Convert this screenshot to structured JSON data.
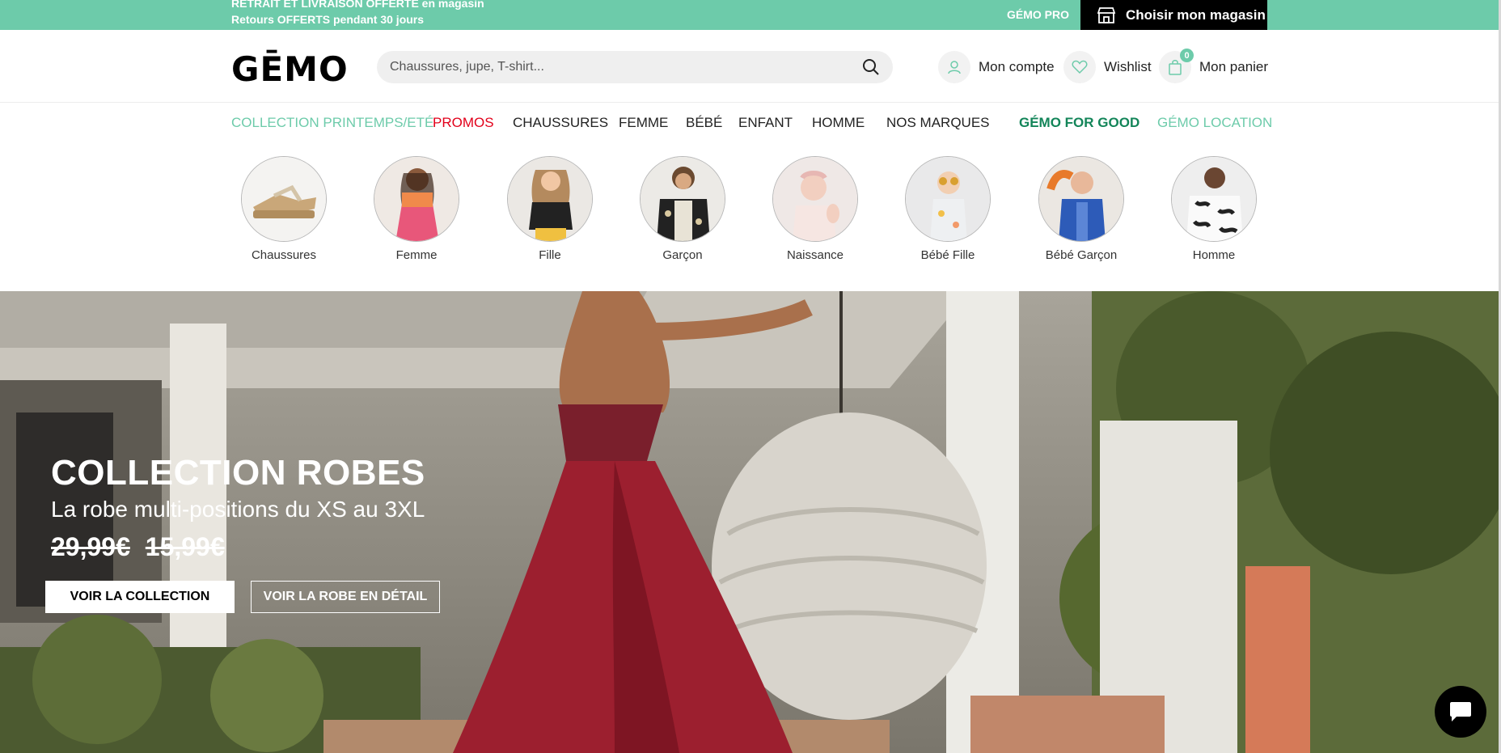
{
  "topbar": {
    "msg_line1": "RETRAIT ET LIVRAISON OFFERTE en magasin",
    "msg_line2": "Retours OFFERTS pendant 30 jours",
    "gemo_pro": "GÉMO PRO",
    "store_button": "Choisir mon magasin"
  },
  "header": {
    "logo": "GĒMO",
    "search_placeholder": "Chaussures, jupe, T-shirt...",
    "account": "Mon compte",
    "wishlist": "Wishlist",
    "cart": "Mon panier",
    "cart_count": "0"
  },
  "nav": {
    "items": [
      "COLLECTION PRINTEMPS/ETÉ",
      "PROMOS",
      "CHAUSSURES",
      "FEMME",
      "BÉBÉ",
      "ENFANT",
      "HOMME",
      "NOS MARQUES",
      "GÉMO FOR GOOD",
      "GÉMO LOCATION"
    ]
  },
  "categories": [
    "Chaussures",
    "Femme",
    "Fille",
    "Garçon",
    "Naissance",
    "Bébé Fille",
    "Bébé Garçon",
    "Homme"
  ],
  "hero": {
    "title": "COLLECTION ROBES",
    "subtitle": "La robe multi-positions du XS au 3XL",
    "price_old": "29,99€",
    "price_new": "15,99€",
    "cta_primary": "VOIR LA COLLECTION",
    "cta_secondary": "VOIR LA ROBE EN DÉTAIL"
  },
  "colors": {
    "brand_green": "#6dcbaa",
    "promo_red": "#e2001a",
    "good_green": "#138559"
  }
}
